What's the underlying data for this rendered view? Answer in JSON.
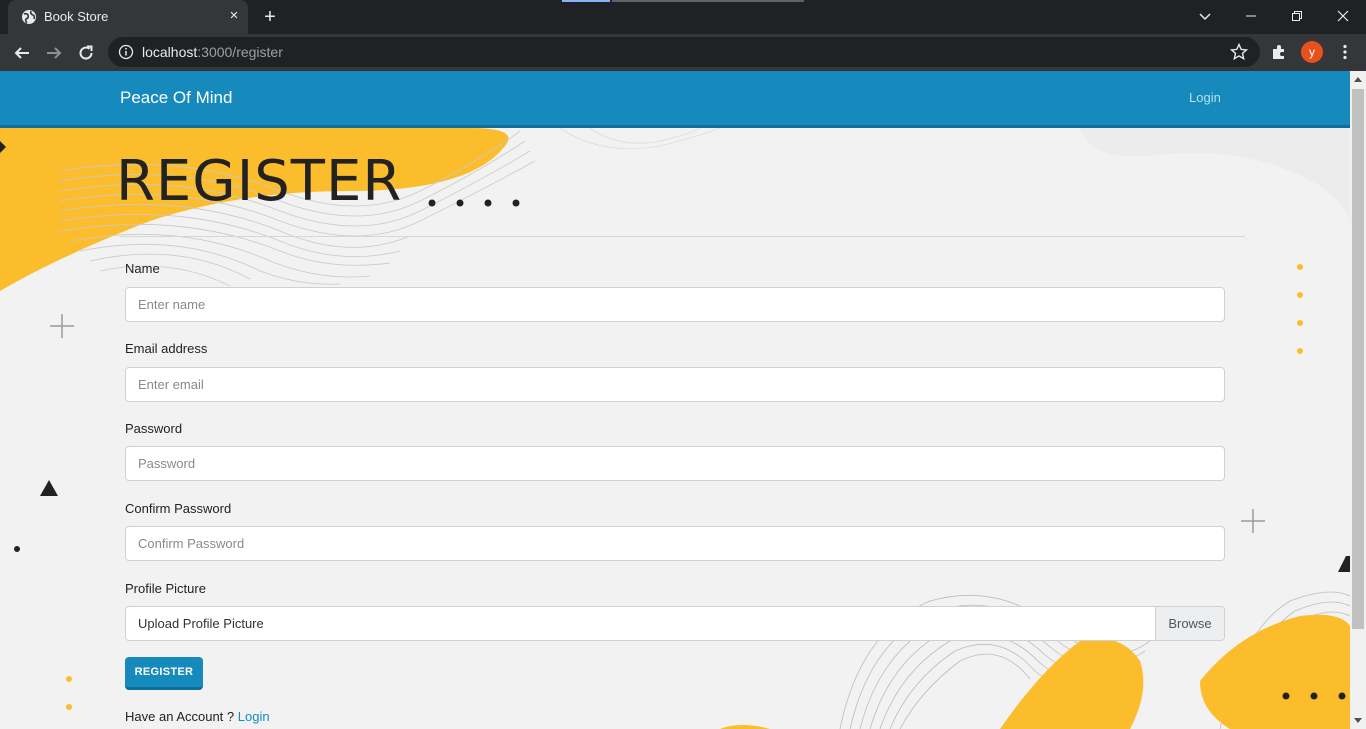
{
  "browser": {
    "tab_title": "Book Store",
    "tab_close": "×",
    "new_tab": "+",
    "url_host": "localhost",
    "url_rest": ":3000/register",
    "avatar_letter": "y"
  },
  "navbar": {
    "brand": "Peace Of Mind",
    "login_link": "Login"
  },
  "page": {
    "title": "REGISTER"
  },
  "form": {
    "name": {
      "label": "Name",
      "placeholder": "Enter name"
    },
    "email": {
      "label": "Email address",
      "placeholder": "Enter email"
    },
    "password": {
      "label": "Password",
      "placeholder": "Password"
    },
    "confirm": {
      "label": "Confirm Password",
      "placeholder": "Confirm Password"
    },
    "picture": {
      "label": "Profile Picture",
      "file_label": "Upload Profile Picture",
      "browse": "Browse"
    },
    "submit": "REGISTER",
    "have_account": "Have an Account ?",
    "login_link": "Login"
  },
  "colors": {
    "navbar": "#178abd",
    "accent_yellow": "#fbbd2b",
    "page_bg": "#f2f2f2"
  },
  "icons": [
    "globe-icon",
    "close-icon",
    "plus-icon",
    "back-arrow-icon",
    "forward-arrow-icon",
    "reload-icon",
    "info-icon",
    "star-icon",
    "extensions-icon",
    "kebab-menu-icon",
    "minimize-icon",
    "restore-icon",
    "window-close-icon"
  ]
}
